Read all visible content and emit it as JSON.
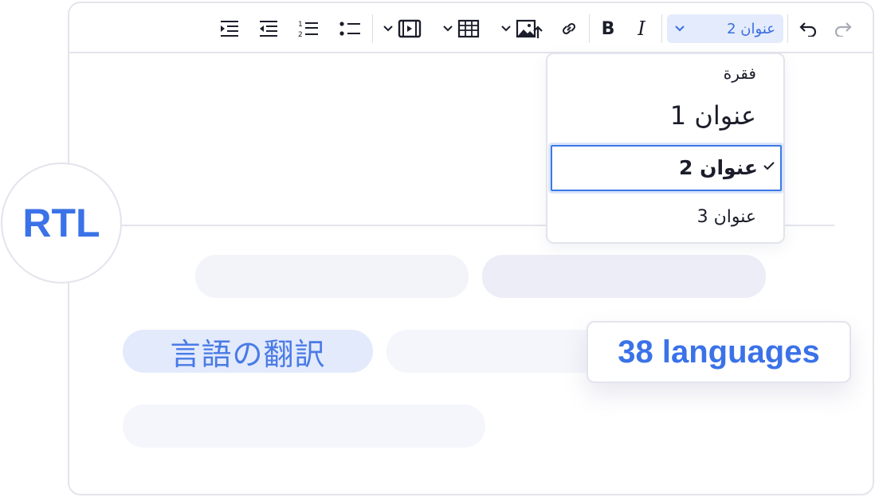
{
  "toolbar": {
    "heading_select_value": "عنوان 2",
    "bold_label": "B",
    "italic_label": "I",
    "icons": [
      "indent-icon",
      "outdent-icon",
      "numbered-list-icon",
      "bulleted-list-icon",
      "media-icon",
      "table-icon",
      "image-upload-icon",
      "link-icon",
      "bold-icon",
      "italic-icon",
      "undo-icon",
      "redo-icon"
    ]
  },
  "heading_dropdown": {
    "options": [
      {
        "label": "فقرة"
      },
      {
        "label": "عنوان 1"
      },
      {
        "label": "عنوان 2",
        "selected": true
      },
      {
        "label": "عنوان 3"
      }
    ]
  },
  "content": {
    "japanese_text": "言語の翻訳"
  },
  "badges": {
    "rtl": "RTL",
    "languages": "38 languages"
  },
  "colors": {
    "accent": "#3b72e8",
    "selection_bg": "#e3ebfc",
    "border": "#e3e4ec",
    "placeholder": "#eff0f8"
  }
}
